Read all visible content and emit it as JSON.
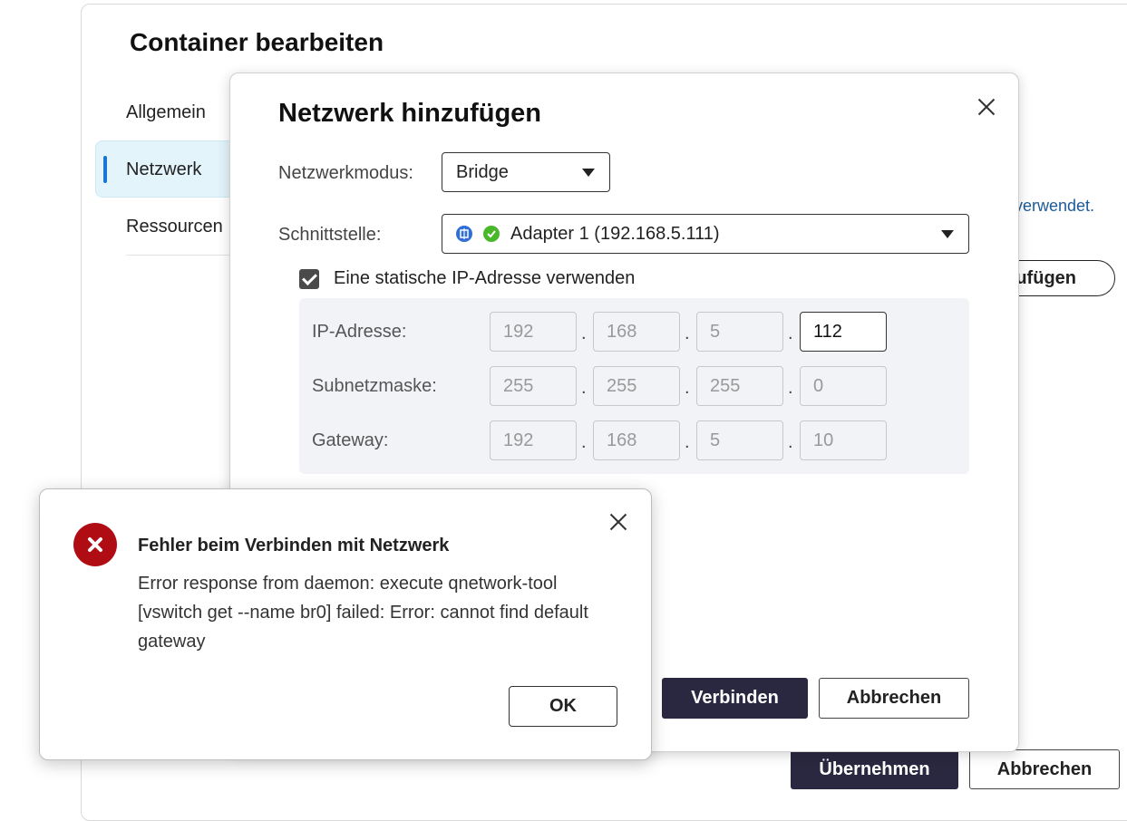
{
  "outer_dialog": {
    "title": "Container bearbeiten",
    "sidebar": [
      {
        "label": "Allgemein",
        "active": false
      },
      {
        "label": "Netzwerk",
        "active": true
      },
      {
        "label": "Ressourcen",
        "active": false
      }
    ],
    "link_fragment": "verwendet.",
    "add_button_fragment": "zufügen",
    "apply_label": "Übernehmen",
    "cancel_label": "Abbrechen"
  },
  "network_dialog": {
    "title": "Netzwerk hinzufügen",
    "mode_label": "Netzwerkmodus:",
    "mode_value": "Bridge",
    "interface_label": "Schnittstelle:",
    "interface_value": "Adapter 1 (192.168.5.111)",
    "static_ip_label": "Eine statische IP-Adresse verwenden",
    "static_ip_checked": true,
    "ip": {
      "label": "IP-Adresse:",
      "octets": [
        "192",
        "168",
        "5",
        "112"
      ]
    },
    "subnet": {
      "label": "Subnetzmaske:",
      "octets": [
        "255",
        "255",
        "255",
        "0"
      ]
    },
    "gateway": {
      "label": "Gateway:",
      "octets": [
        "192",
        "168",
        "5",
        "10"
      ]
    },
    "connect_label": "Verbinden",
    "cancel_label": "Abbrechen"
  },
  "error_dialog": {
    "title": "Fehler beim Verbinden mit Netzwerk",
    "message": "Error response from daemon: execute qnetwork-tool [vswitch get --name br0] failed: Error: cannot find default gateway",
    "ok_label": "OK"
  },
  "colors": {
    "primary_button": "#2a2840",
    "error_icon": "#b00c14",
    "active_tab_bg": "#e3f4fb",
    "active_tab_bar": "#1976d2",
    "link": "#1c5a9a"
  }
}
